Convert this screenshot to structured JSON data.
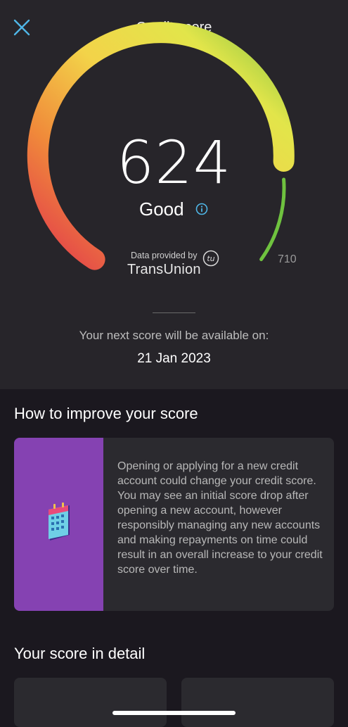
{
  "header": {
    "title": "Credit score",
    "close_icon": "close-icon"
  },
  "gauge": {
    "score": "624",
    "rating": "Good",
    "max_label": "710",
    "score_value": 624,
    "max_value": 710,
    "colors": {
      "low": "#e23a4c",
      "mid": "#f3a73b",
      "high": "#f0e24a",
      "good": "#7cc242",
      "accent": "#4fb6e6"
    }
  },
  "provider": {
    "provided_by": "Data provided by",
    "name": "TransUnion",
    "logo_text": "tu"
  },
  "next_score": {
    "label": "Your next score will be available on:",
    "date": "21 Jan 2023"
  },
  "improve": {
    "title": "How to improve your score",
    "tip_text": "Opening or applying for a new credit account could change your credit score. You may see an initial score drop after opening a new account, however responsibly managing any new accounts and making repayments on time could result in an overall increase to your credit score over time.",
    "illustration_icon": "calendar-icon",
    "illustration_color": "#8542b2"
  },
  "detail": {
    "title": "Your score in detail"
  }
}
